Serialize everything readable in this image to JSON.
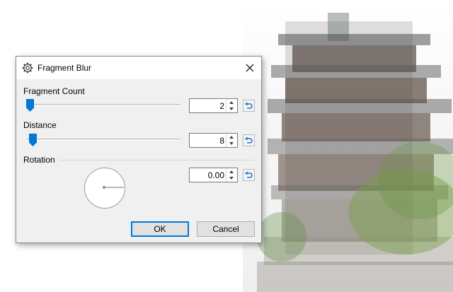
{
  "dialog": {
    "title": "Fragment Blur",
    "title_icon": "gear-icon",
    "close_icon": "close-icon"
  },
  "fragment_count": {
    "label": "Fragment Count",
    "value": "2",
    "slider_fraction": 0.02
  },
  "distance": {
    "label": "Distance",
    "value": "8",
    "slider_fraction": 0.04
  },
  "rotation": {
    "label": "Rotation",
    "value": "0.00",
    "angle_degrees": 0
  },
  "buttons": {
    "ok": "OK",
    "cancel": "Cancel"
  },
  "colors": {
    "accent": "#0078d7",
    "dialog_bg": "#f0f0f0"
  }
}
